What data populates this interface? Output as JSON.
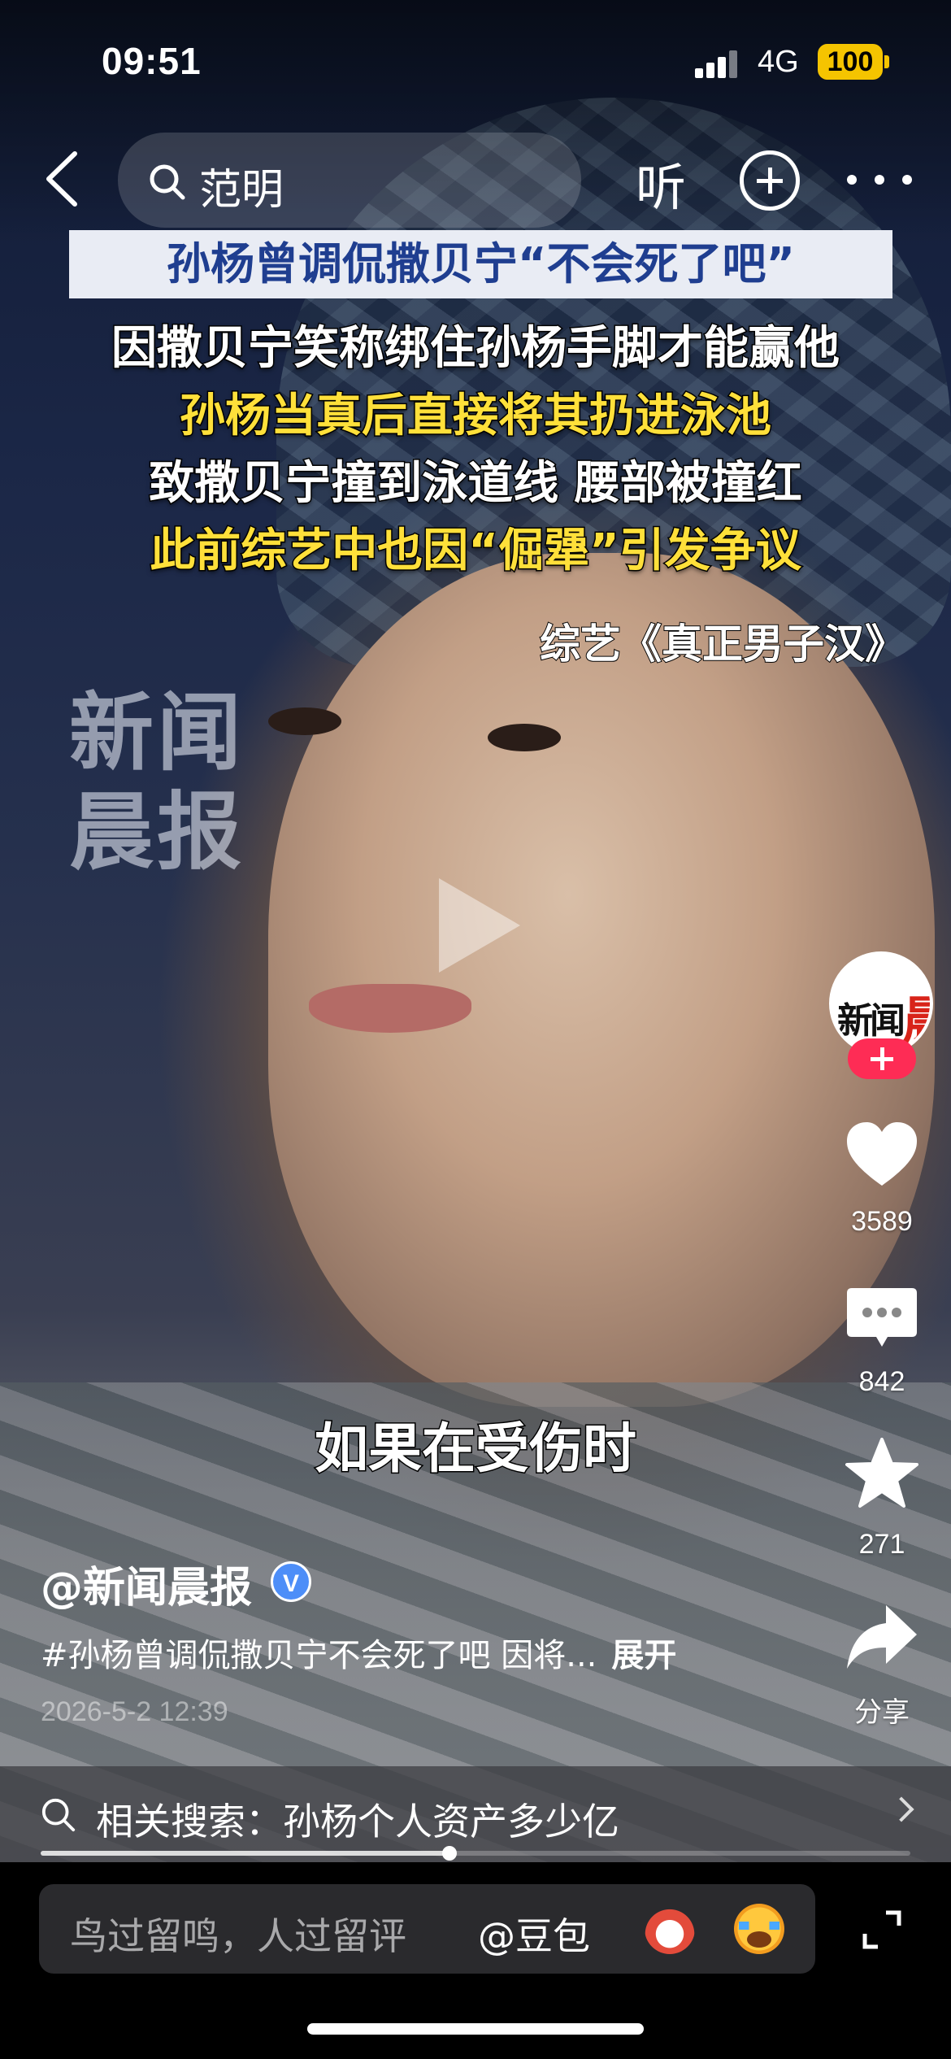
{
  "status_bar": {
    "time": "09:51",
    "network": "4G",
    "battery": "100"
  },
  "top_nav": {
    "search_query": "范明",
    "listen_label": "听"
  },
  "video": {
    "headline": "孙杨曾调侃撒贝宁“不会死了吧”",
    "caption_lines": [
      "因撒贝宁笑称绑住孙杨手脚才能赢他",
      "孙杨当真后直接将其扔进泳池",
      "致撒贝宁撞到泳道线 腰部被撞红",
      "此前综艺中也因“倔犟”引发争议"
    ],
    "show_name": "综艺《真正男子汉》",
    "watermark": "新闻晨报",
    "subtitle": "如果在受伤时",
    "progress": 0.47
  },
  "actions": {
    "likes": "3589",
    "comments": "842",
    "favorites": "271",
    "share_label": "分享"
  },
  "post": {
    "author": "@新闻晨报",
    "verified_mark": "V",
    "description": "#孙杨曾调侃撒贝宁不会死了吧 因将...",
    "expand_label": "展开",
    "date": "2026-5-2 12:39"
  },
  "related_search": {
    "text": "相关搜索：孙杨个人资产多少亿"
  },
  "comment_bar": {
    "placeholder": "鸟过留鸣，人过留评",
    "mention": "@豆包"
  },
  "colors": {
    "headline_text": "#1f3e90",
    "caption_yellow": "#ffe03a",
    "follow_red": "#fe2c55",
    "battery": "#f5c400",
    "verified_blue": "#4d8ef8"
  }
}
